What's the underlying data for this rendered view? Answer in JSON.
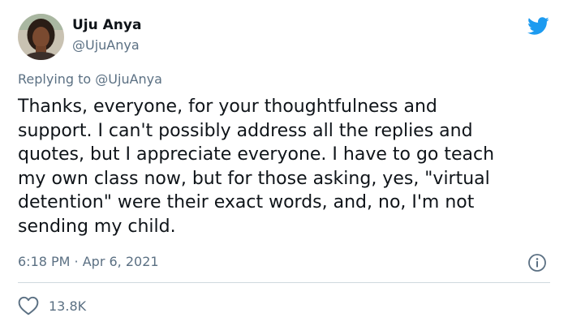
{
  "author": {
    "display_name": "Uju Anya",
    "handle": "@UjuAnya"
  },
  "reply_context": {
    "prefix": "Replying to ",
    "mention": "@UjuAnya"
  },
  "tweet": {
    "text": "Thanks, everyone, for your thoughtfulness and\nsupport. I can't possibly address all the replies and\nquotes, but I appreciate everyone. I have to go teach\nmy own class now, but for those asking, yes, \"virtual\ndetention\" were their exact words, and, no, I'm not\nsending my child.",
    "timestamp": "6:18 PM · Apr 6, 2021"
  },
  "engagement": {
    "likes": "13.8K"
  },
  "icons": {
    "brand": "twitter-bird-icon",
    "info": "info-icon",
    "like": "heart-icon"
  },
  "colors": {
    "brand": "#1d9bf0",
    "text": "#0f1419",
    "muted": "#5b7083",
    "divider": "#cfd9de"
  }
}
